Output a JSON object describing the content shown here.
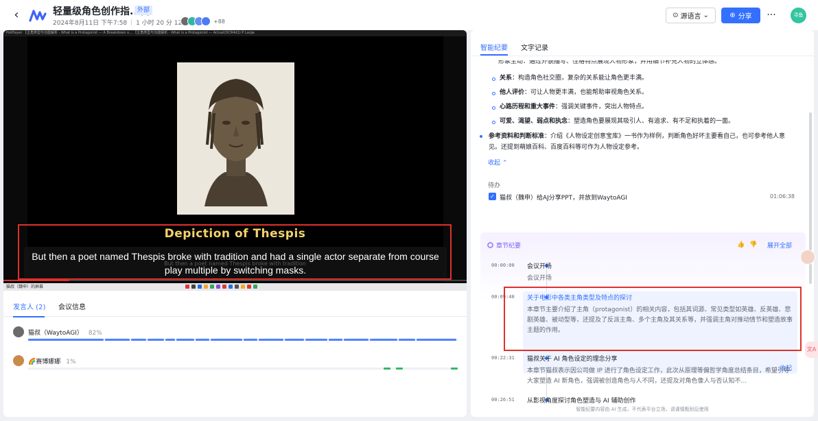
{
  "header": {
    "title": "轻量级角色创作指...门",
    "badge": "外部",
    "date": "2024年8月11日 下午7:58",
    "duration": "1 小时 20 分 12 秒",
    "participants_more": "+88",
    "source_language_label": "源语言",
    "share_label": "分享",
    "more_label": "···",
    "user_avatar_text": "寻鱼"
  },
  "video": {
    "top_strip_text": "PotPlayer   【主角类型与功能解析 - What is a Protagonist — A Breakdown o...  【主角类型与功能解析 - What is a Protagonist — Actual(OCR4d1) P Large",
    "slide_heading": "Depiction of Thespis",
    "subtitle": "But then a poet named Thespis broke with tradition and had a single actor separate from course play multiple by switching masks.",
    "ghost_text": "But then a poet named Thespis broke with tradition",
    "taskbar_text": "猫叔（魏申）的屏幕"
  },
  "left_tabs": [
    {
      "label": "发言人 (2)",
      "active": true
    },
    {
      "label": "会议信息",
      "active": false
    }
  ],
  "speakers": [
    {
      "name": "猫叔（WaytoAGI）",
      "pct": "82%",
      "avatar_color": "#6b6b6b"
    },
    {
      "name": "🌈赛博娜娜",
      "pct": "1%",
      "avatar_color": "#c98a4b"
    }
  ],
  "right_tabs": [
    {
      "label": "智能纪要",
      "active": true
    },
    {
      "label": "文字记录",
      "active": false
    }
  ],
  "summary": {
    "cut_line": "形象生动：通过外貌描写、性格特点展现人物形象，并用细节补充人物的立体感。",
    "sub_items": [
      {
        "label": "关系",
        "text": "：构造角色社交圈，复杂的关系能让角色更丰满。"
      },
      {
        "label": "他人评价",
        "text": "：可让人物更丰满，也能帮助审视角色关系。"
      },
      {
        "label": "心路历程和重大事件",
        "text": "：强调关键事件，突出人物特点。"
      },
      {
        "label": "可爱、渴望、弱点和执念",
        "text": "：塑造角色要展现其吸引人、有追求、有不足和执着的一面。"
      }
    ],
    "main_item": {
      "label": "参考资料和判断标准",
      "text": "：介绍《人物设定创意宝库》一书作为样例，判断角色好坏主要看自己，也可参考他人意见。还提到萌娘百科、百度百科等可作为人物设定参考。"
    },
    "collapse_label": "收起 ⌃"
  },
  "todo": {
    "title": "待办",
    "text": "猫叔（魏申）给AJ分享PPT，并放到WaytoAGI",
    "time": "01:06:38"
  },
  "chapters": {
    "title": "章节纪要",
    "expand_all": "展开全部",
    "collapse_label": "收起",
    "items": [
      {
        "time": "00:00:00",
        "head": "会议开场",
        "body": "会议开场"
      },
      {
        "time": "00:09:40",
        "head": "关于电影中各类主角类型及特点的探讨",
        "body": "本章节主要介绍了主角（protagonist）的相关内容，包括其词源、常见类型如英雄、反英雄、悲剧英雄、被动型等，还提及了反派主角、多个主角及其关系等，并强调主角对推动情节和塑造故事主题的作用。"
      },
      {
        "time": "00:22:31",
        "head": "猫叔关于 AI 角色设定的理念分享",
        "body": "本章节猫叔表示因公司做 IP 进行了角色设定工作，此次从原理等偏哲学角度总结条目，希望引导大家塑造 AI 新角色，强调被创造角色与人不同，还提及对角色像人与否认知不..."
      },
      {
        "time": "00:26:51",
        "head": "从影视角度探讨角色塑造与 AI 辅助创作",
        "body": ""
      }
    ]
  },
  "footer_note": "智能纪要内容由 AI 生成，不代表平台立场，请谨慎甄别后使用",
  "float_translate_label": "文A",
  "colors": {
    "accent": "#3370ff",
    "highlight_red": "#e0302c",
    "chapter_purple": "#7f5ff5"
  }
}
